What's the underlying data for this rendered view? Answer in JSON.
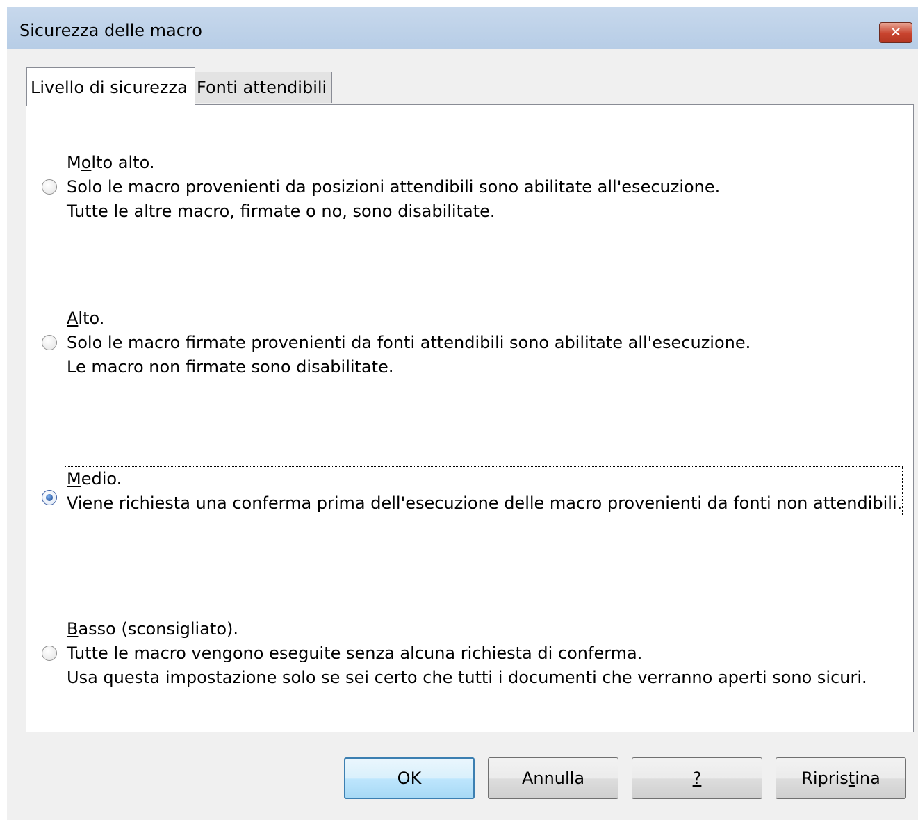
{
  "window": {
    "title": "Sicurezza delle macro",
    "close_glyph": "✕"
  },
  "tabs": [
    {
      "label": "Livello di sicurezza",
      "active": true
    },
    {
      "label": "Fonti attendibili",
      "active": false
    }
  ],
  "options": [
    {
      "title_a": "M",
      "title_u": "o",
      "title_b": "lto alto.",
      "line1": "Solo le macro provenienti da posizioni attendibili sono abilitate all'esecuzione.",
      "line2": "Tutte le altre macro, firmate o no, sono disabilitate.",
      "selected": false
    },
    {
      "title_a": "",
      "title_u": "A",
      "title_b": "lto.",
      "line1": "Solo le macro firmate provenienti da fonti attendibili sono abilitate all'esecuzione.",
      "line2": "Le macro non firmate sono disabilitate.",
      "selected": false
    },
    {
      "title_a": "",
      "title_u": "M",
      "title_b": "edio.",
      "line1": "Viene richiesta una conferma prima dell'esecuzione delle macro provenienti da fonti non attendibili.",
      "selected": true
    },
    {
      "title_a": "",
      "title_u": "B",
      "title_b": "asso (sconsigliato).",
      "line1": "Tutte le macro vengono eseguite senza alcuna richiesta di conferma.",
      "line2": "Usa questa impostazione solo se sei certo che tutti i documenti che verranno aperti sono sicuri.",
      "selected": false
    }
  ],
  "buttons": {
    "ok": "OK",
    "cancel": "Annulla",
    "help": "?",
    "reset_a": "Ripris",
    "reset_u": "t",
    "reset_b": "ina"
  }
}
